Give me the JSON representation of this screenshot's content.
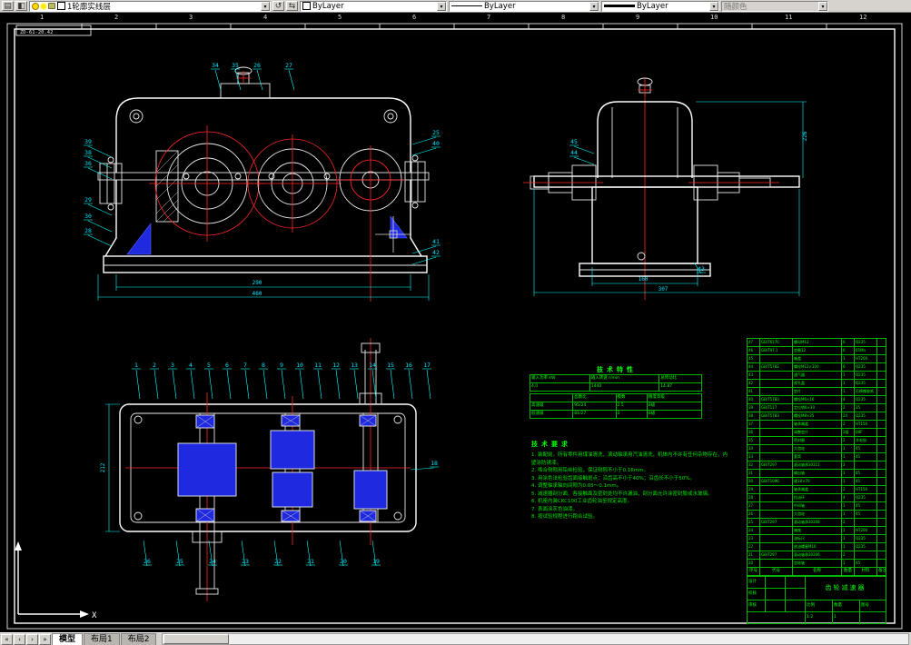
{
  "toolbar": {
    "layer": "1轮廓实线层",
    "color": "ByLayer",
    "linetype": "ByLayer",
    "lineweight": "ByLayer",
    "plotstyle": "随颜色"
  },
  "icons": {
    "layer_manager": "▤",
    "make_current": "◧",
    "layer_previous": "↺",
    "layer_states": "⇆",
    "dropdown": "▾",
    "tab_first": "«",
    "tab_prev": "‹",
    "tab_next": "›",
    "tab_last": "»"
  },
  "tabs": [
    "模型",
    "布局1",
    "布局2"
  ],
  "canvas": {
    "zones": [
      "1",
      "2",
      "3",
      "4",
      "5",
      "6",
      "7",
      "8",
      "9",
      "10",
      "11",
      "12"
    ],
    "sheet_label": "ZD-61-20.42",
    "ucs_x": "X"
  },
  "colors": {
    "line": "#ffffff",
    "centerline": "#ff2626",
    "dimension": "#00ffff",
    "table": "#00ff00",
    "section_fill": "#1f2ae0"
  },
  "dims": {
    "front": [
      "290",
      "460"
    ],
    "side": [
      "160",
      "307",
      "226"
    ],
    "plan": [
      "212"
    ]
  },
  "balloons": {
    "front_top": [
      "34",
      "35",
      "26",
      "27"
    ],
    "front_left": [
      "39",
      "38",
      "36",
      "29",
      "30",
      "28"
    ],
    "front_right": [
      "25",
      "40",
      "41",
      "42"
    ],
    "side_left": [
      "45",
      "44"
    ],
    "side_bottom": [
      "43"
    ],
    "plan_top": [
      "1",
      "2",
      "3",
      "4",
      "5",
      "6",
      "7",
      "8",
      "9",
      "10",
      "11",
      "12",
      "13",
      "14",
      "15",
      "16",
      "17"
    ],
    "plan_bottom": [
      "26",
      "25",
      "24",
      "23",
      "22",
      "21",
      "20",
      "19"
    ],
    "plan_right": [
      "18"
    ]
  },
  "tech": {
    "title": "技术特性",
    "table1": [
      [
        "输入功率 kW",
        "输入转速 r/min",
        "总传动比"
      ],
      [
        "4.0",
        "1440",
        "14.87"
      ]
    ],
    "table2": [
      [
        "",
        "齿数比",
        "模数",
        "精度等级"
      ],
      [
        "高速级",
        "95/24",
        "2.5",
        "8级"
      ],
      [
        "低速级",
        "81/27",
        "3",
        "8级"
      ]
    ]
  },
  "notes": {
    "title": "技术要求",
    "items": [
      "装配前，所有零件用煤油清洗，滚动轴承用汽油清洗，机体内不许有任何杂物存在，内壁涂防锈漆。",
      "啮合侧隙用铅丝检验，保证侧隙不小于0.16mm。",
      "用涂色法检验齿面接触斑点：沿齿高不小于40%；沿齿长不小于50%。",
      "调整轴承轴向间隙为0.05～0.1mm。",
      "减速器剖分面、各接触面及密封处均不许漏油，剖分面允许涂密封胶或水玻璃。",
      "机座内装CKC100工业齿轮油至规定高度。",
      "表面涂灰色油漆。",
      "按试验规程进行跑合试验。"
    ]
  },
  "bom": {
    "header": [
      "序号",
      "代号",
      "名称",
      "数量",
      "材料",
      "备注"
    ],
    "rows": [
      [
        "47",
        "GB/T6170",
        "螺母M12",
        "6",
        "Q235",
        ""
      ],
      [
        "46",
        "GB/T97.1",
        "垫圈12",
        "6",
        "65Mn",
        ""
      ],
      [
        "45",
        "",
        "箱盖",
        "1",
        "HT200",
        ""
      ],
      [
        "44",
        "GB/T5782",
        "螺栓M12×100",
        "6",
        "Q235",
        ""
      ],
      [
        "43",
        "",
        "通气器",
        "1",
        "Q235",
        ""
      ],
      [
        "42",
        "",
        "视孔盖",
        "1",
        "Q235",
        ""
      ],
      [
        "41",
        "",
        "垫片",
        "1",
        "石棉橡胶纸",
        ""
      ],
      [
        "40",
        "GB/T5783",
        "螺栓M6×16",
        "4",
        "Q235",
        ""
      ],
      [
        "39",
        "GB/T117",
        "定位销6×30",
        "2",
        "35",
        ""
      ],
      [
        "38",
        "GB/T5783",
        "螺栓M8×25",
        "24",
        "Q235",
        ""
      ],
      [
        "37",
        "",
        "轴承端盖",
        "2",
        "HT150",
        ""
      ],
      [
        "36",
        "",
        "调整垫片",
        "2组",
        "08F",
        ""
      ],
      [
        "35",
        "",
        "密封圈",
        "2",
        "羊毛毡",
        ""
      ],
      [
        "34",
        "",
        "大齿轮",
        "1",
        "45",
        ""
      ],
      [
        "33",
        "",
        "套筒",
        "1",
        "45",
        ""
      ],
      [
        "32",
        "GB/T297",
        "滚动轴承30211",
        "2",
        "",
        ""
      ],
      [
        "31",
        "",
        "输出轴",
        "1",
        "45",
        ""
      ],
      [
        "30",
        "GB/T1096",
        "键18×70",
        "1",
        "45",
        ""
      ],
      [
        "29",
        "",
        "轴承端盖",
        "2",
        "HT150",
        ""
      ],
      [
        "28",
        "",
        "挡油环",
        "4",
        "Q235",
        ""
      ],
      [
        "27",
        "",
        "中间轴",
        "1",
        "45",
        ""
      ],
      [
        "26",
        "",
        "大齿轮",
        "1",
        "45",
        ""
      ],
      [
        "25",
        "GB/T297",
        "滚动轴承30208",
        "2",
        "",
        ""
      ],
      [
        "24",
        "",
        "箱座",
        "1",
        "HT200",
        ""
      ],
      [
        "23",
        "",
        "油标尺",
        "1",
        "Q235",
        ""
      ],
      [
        "22",
        "",
        "放油螺塞M16",
        "1",
        "Q235",
        ""
      ],
      [
        "21",
        "GB/T297",
        "滚动轴承30206",
        "2",
        "",
        ""
      ],
      [
        "20",
        "",
        "齿轮轴",
        "1",
        "45",
        ""
      ]
    ]
  },
  "titleblock": {
    "title": "齿轮减速器",
    "design": "设计",
    "check": "校核",
    "approve": "审核",
    "scale_label": "比例",
    "scale": "1:2",
    "qty_label": "数量",
    "qty": "1",
    "code_label": "图号",
    "code": ""
  }
}
